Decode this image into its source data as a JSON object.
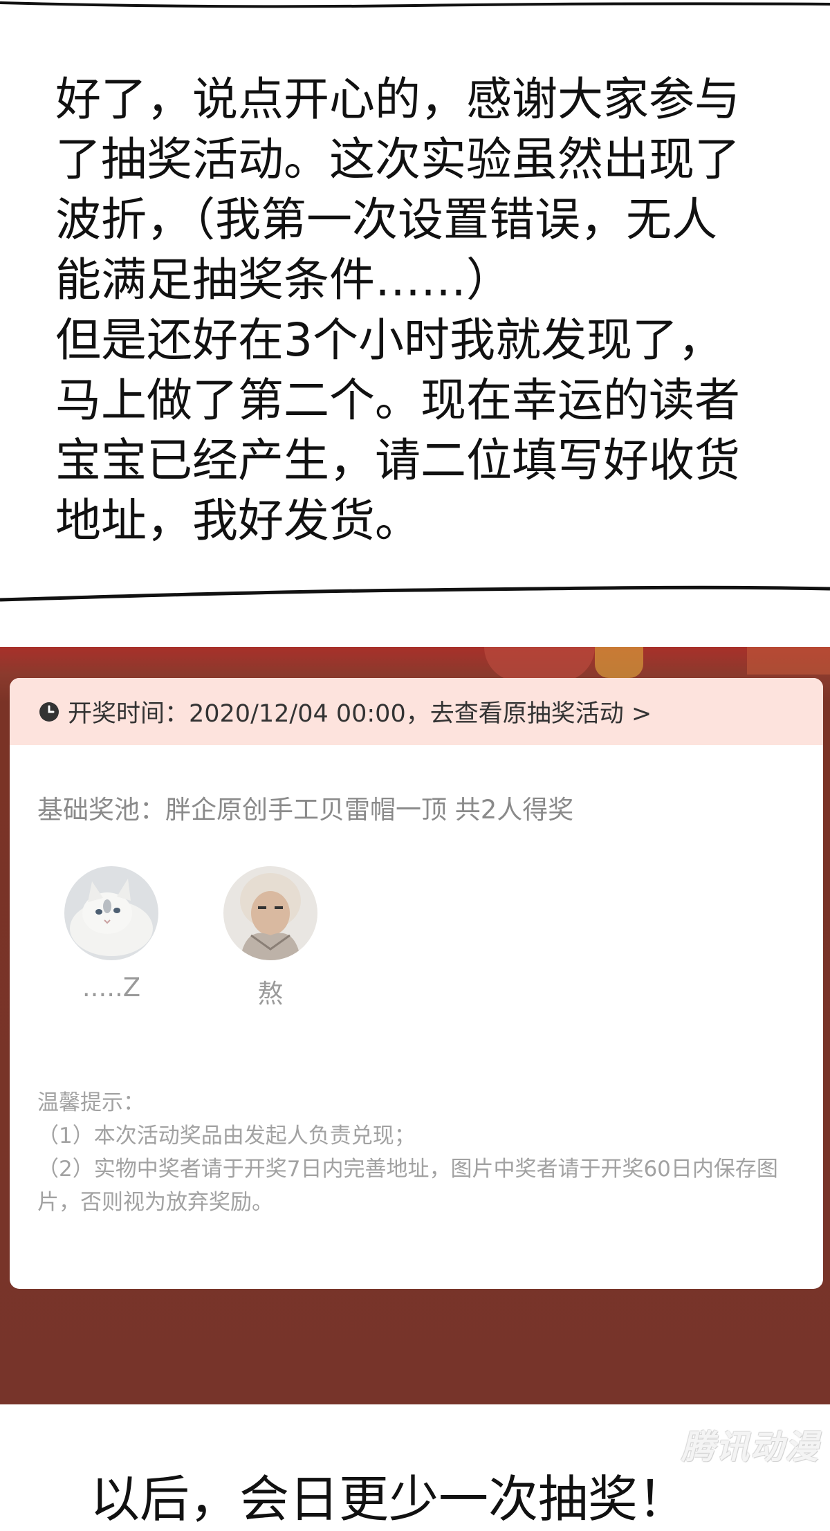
{
  "speech_bubble": {
    "lines": [
      "好了，说点开心的，感谢大家参与",
      "了抽奖活动。这次实验虽然出现了",
      "波折，（我第一次设置错误，无人",
      "能满足抽奖条件……）",
      "但是还好在3个小时我就发现了，",
      "马上做了第二个。现在幸运的读者",
      "宝宝已经产生，请二位填写好收货",
      "地址，我好发货。"
    ]
  },
  "lottery_card": {
    "header_text": "开奖时间：2020/12/04 00:00，去查看原抽奖活动 >",
    "pool_text": "基础奖池：胖企原创手工贝雷帽一顶 共2人得奖",
    "winners": [
      {
        "name": ".....Z",
        "avatar_icon": "cat-avatar-icon"
      },
      {
        "name": "熬",
        "avatar_icon": "person-avatar-icon"
      }
    ],
    "tips_title": "温馨提示：",
    "tips": [
      "（1）本次活动奖品由发起人负责兑现；",
      "（2）实物中奖者请于开奖7日内完善地址，图片中奖者请于开奖60日内保存图片，否则视为放弃奖励。"
    ]
  },
  "bottom_panel": {
    "text": "以后，会日更少一次抽奖！"
  },
  "watermark": "腾讯动漫",
  "colors": {
    "header_bg": "#fde3dd",
    "page_bg_red": "#77342a",
    "muted_text": "#8a8a8a"
  }
}
